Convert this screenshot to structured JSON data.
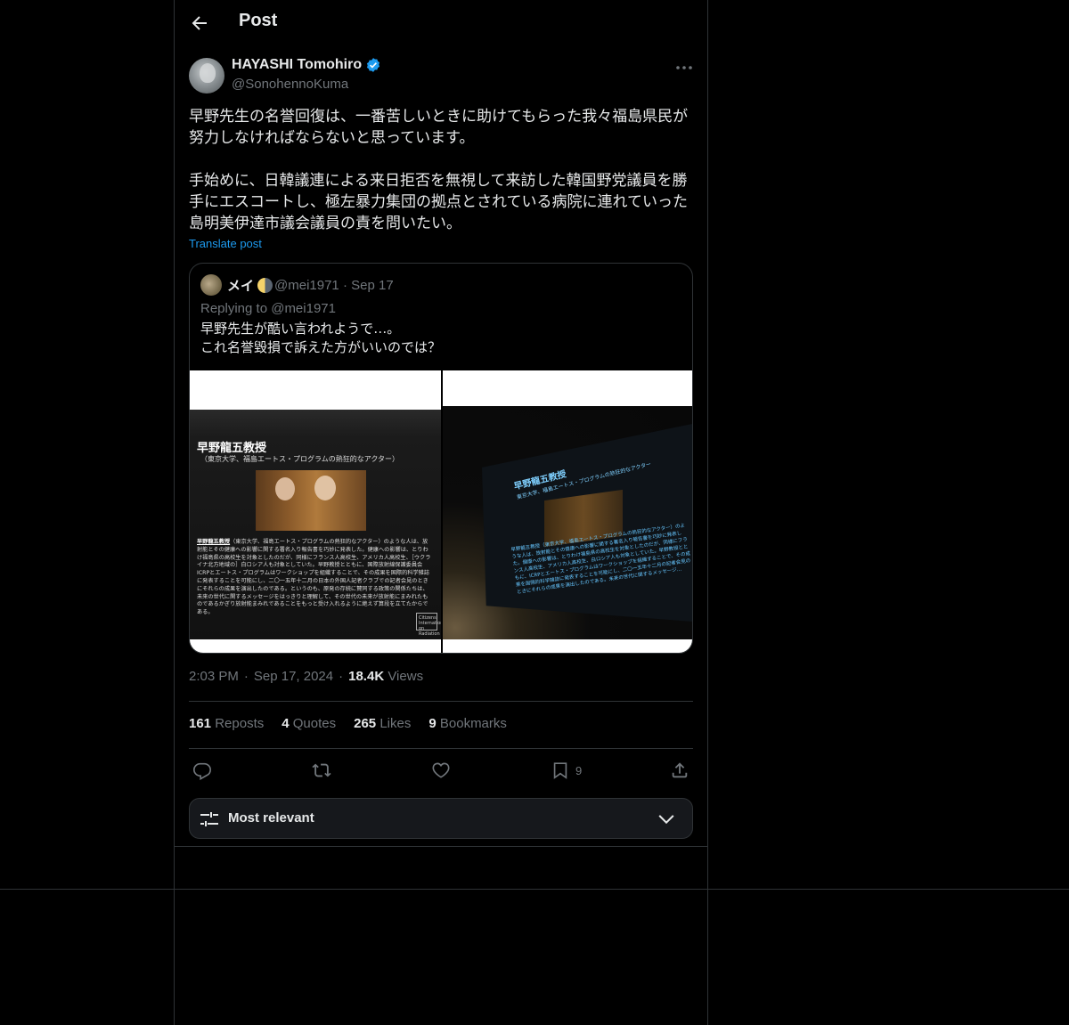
{
  "header": {
    "title": "Post"
  },
  "post": {
    "author_name": "HAYASHI Tomohiro",
    "author_handle": "@SonohennoKuma",
    "text": "早野先生の名誉回復は、一番苦しいときに助けてもらった我々福島県民が努力しなければならないと思っています。\n\n手始めに、日韓議連による来日拒否を無視して来訪した韓国野党議員を勝手にエスコートし、極左暴力集団の拠点とされている病院に連れていった島明美伊達市議会議員の責を問いたい。",
    "translate_label": "Translate post",
    "time": "2:03 PM",
    "date": "Sep 17, 2024",
    "views_count": "18.4K",
    "views_label": "Views"
  },
  "quote": {
    "author_name": "メイ",
    "author_handle": "@mei1971",
    "date": "Sep 17",
    "replying_to": "Replying to @mei1971",
    "text": "早野先生が酷い言われようで…。\nこれ名誉毀損で訴えた方がいいのでは？",
    "image1": {
      "title": "早野龍五教授",
      "subtitle": "（東京大学、福島エートス・プログラムの熱狂的なアクター）",
      "body_highlight": "早野龍五教授",
      "body": "（東京大学、福島エートス・プログラムの熱狂的なアクター）のような人は、放射能とその健康への影響に関する署名入り報告書を巧妙に発表した。健康への影響は、とりわけ福島県の高校生を対象としたのだが、同様にフランス人高校生、アメリカ人高校生、［ウクライナ北方地域の］白ロシア人も対象としていた。早野教授とともに、国際放射線保護委員会ICRPとエートス・プログラムはワークショップを組織することで、その成果を国際的科学雑誌に発表することを可能にし、二〇一五年十二月の日本の外国人記者クラブでの記者会見のときにそれらの成果を演出したのである。というのも、原発の存続に賛同する政策の関係たちは、未来の世代に関するメッセージをはっきりと理解して、その世代の未来が放射能にまみれたものであるかぎり放射能まみれであることをもっと受け入れるように絶えず算段を立てたからである。",
      "logo": "Citizens International on Radiation"
    },
    "image2": {
      "title": "早野龍五教授",
      "subtitle": "東京大学、福島エートス・プログラムの熱狂的なアクター",
      "body": "早野龍五教授（東京大学、福島エートス・プログラムの熱狂的なアクター）のような人は、放射能とその健康への影響に関する署名入り報告書を巧妙に発表した。健康への影響は、とりわけ福島県の高校生を対象としたのだが、同様にフランス人高校生、アメリカ人高校生、白ロシア人も対象としていた。早野教授とともに、ICRPとエートス・プログラムはワークショップを組織することで、その成果を国際的科学雑誌に発表することを可能にし、二〇一五年十二月の記者会見のときにそれらの成果を演出したのである。未来の世代に関するメッセージ…"
    }
  },
  "stats": {
    "reposts_count": "161",
    "reposts_label": "Reposts",
    "quotes_count": "4",
    "quotes_label": "Quotes",
    "likes_count": "265",
    "likes_label": "Likes",
    "bookmarks_count": "9",
    "bookmarks_label": "Bookmarks"
  },
  "actions": {
    "bookmark_count": "9"
  },
  "sort": {
    "label": "Most relevant"
  },
  "colors": {
    "accent": "#1d9bf0",
    "background": "#000000",
    "border": "#2f3336",
    "muted": "#71767b"
  }
}
